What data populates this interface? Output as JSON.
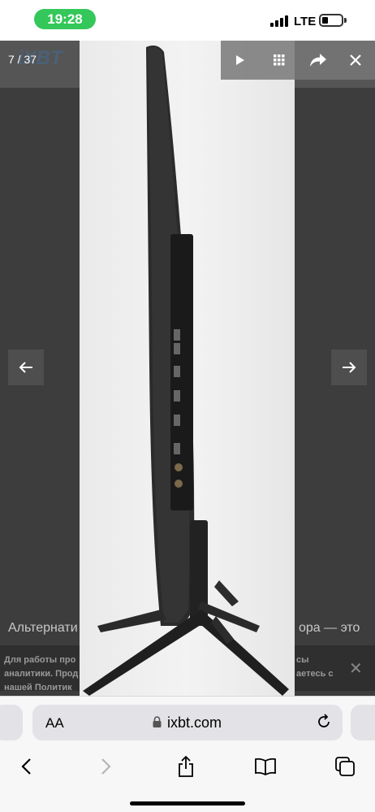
{
  "status_bar": {
    "time": "19:28",
    "network": "LTE"
  },
  "gallery": {
    "counter": "7 / 37",
    "background_logo": "iXBT",
    "background_text_left": "Альтернати",
    "background_text_right": "ора — это",
    "cookie_left": "Для работы про\nаналитики. Прод\nнашей Политик",
    "cookie_right": "сы\nаетесь с",
    "toolbar": {
      "play_icon": "play-icon",
      "grid_icon": "grid-icon",
      "share_icon": "share-icon",
      "close_icon": "close-icon"
    },
    "prev_icon": "arrow-left-icon",
    "next_icon": "arrow-right-icon",
    "photo_alt": "Curved TV side view on stand"
  },
  "safari": {
    "text_size_label": "AA",
    "url": "ixbt.com",
    "colors": {
      "accent": "#34c759",
      "toolbar_bg": "#f7f7f7"
    }
  }
}
